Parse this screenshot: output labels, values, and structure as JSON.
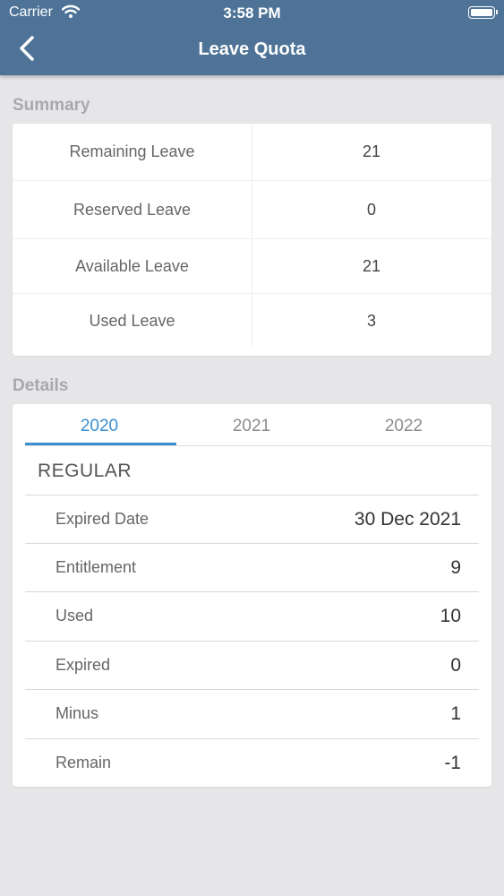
{
  "status_bar": {
    "carrier": "Carrier",
    "time": "3:58 PM"
  },
  "header": {
    "title": "Leave Quota"
  },
  "summary": {
    "label": "Summary",
    "rows": [
      {
        "label": "Remaining Leave",
        "value": "21"
      },
      {
        "label": "Reserved Leave",
        "value": "0"
      },
      {
        "label": "Available Leave",
        "value": "21"
      },
      {
        "label": "Used Leave",
        "value": "3"
      }
    ]
  },
  "details": {
    "label": "Details",
    "tabs": [
      "2020",
      "2021",
      "2022"
    ],
    "active_tab": "2020",
    "group_title": "REGULAR",
    "rows": [
      {
        "label": "Expired Date",
        "value": "30 Dec 2021"
      },
      {
        "label": "Entitlement",
        "value": "9"
      },
      {
        "label": "Used",
        "value": "10"
      },
      {
        "label": "Expired",
        "value": "0"
      },
      {
        "label": "Minus",
        "value": "1"
      },
      {
        "label": "Remain",
        "value": "-1"
      }
    ]
  },
  "colors": {
    "header": "#4e7397",
    "accent": "#3a8fcf",
    "background": "#e6e5e7"
  },
  "icons": {
    "back": "chevron-left-icon",
    "wifi": "wifi-icon",
    "battery": "battery-icon"
  }
}
